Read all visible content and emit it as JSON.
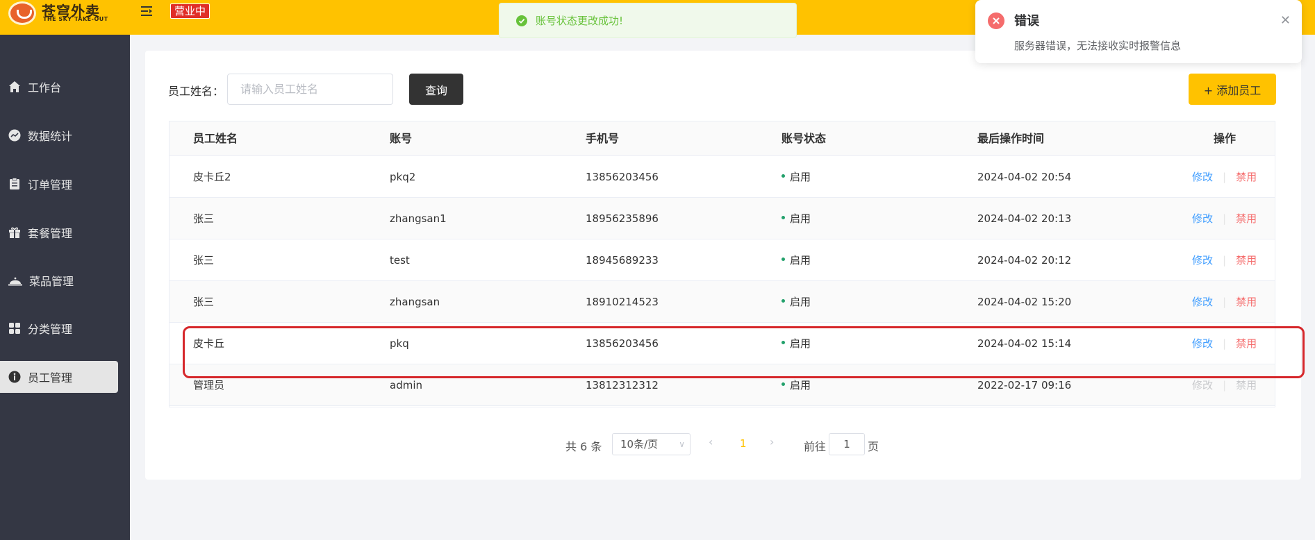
{
  "app": {
    "logo_title": "苍穹外卖",
    "logo_subtitle": "THE SKY TAKE-OUT",
    "shop_status": "营业中"
  },
  "sidebar": {
    "items": [
      {
        "label": "工作台",
        "icon": "home-icon"
      },
      {
        "label": "数据统计",
        "icon": "chart-icon"
      },
      {
        "label": "订单管理",
        "icon": "clipboard-icon"
      },
      {
        "label": "套餐管理",
        "icon": "gift-icon"
      },
      {
        "label": "菜品管理",
        "icon": "cloche-icon"
      },
      {
        "label": "分类管理",
        "icon": "grid-icon"
      },
      {
        "label": "员工管理",
        "icon": "employee-icon",
        "active": true
      }
    ]
  },
  "toolbar": {
    "name_label": "员工姓名：",
    "name_placeholder": "请输入员工姓名",
    "query_label": "查询",
    "add_label": "+ 添加员工"
  },
  "table": {
    "headers": [
      "员工姓名",
      "账号",
      "手机号",
      "账号状态",
      "最后操作时间",
      "操作"
    ],
    "edit_label": "修改",
    "disable_label": "禁用",
    "rows": [
      {
        "name": "皮卡丘2",
        "account": "pkq2",
        "phone": "13856203456",
        "status": "启用",
        "time": "2024-04-02 20:54"
      },
      {
        "name": "张三",
        "account": "zhangsan1",
        "phone": "18956235896",
        "status": "启用",
        "time": "2024-04-02 20:13"
      },
      {
        "name": "张三",
        "account": "test",
        "phone": "18945689233",
        "status": "启用",
        "time": "2024-04-02 20:12"
      },
      {
        "name": "张三",
        "account": "zhangsan",
        "phone": "18910214523",
        "status": "启用",
        "time": "2024-04-02 15:20"
      },
      {
        "name": "皮卡丘",
        "account": "pkq",
        "phone": "13856203456",
        "status": "启用",
        "time": "2024-04-02 15:14"
      },
      {
        "name": "管理员",
        "account": "admin",
        "phone": "13812312312",
        "status": "启用",
        "time": "2022-02-17 09:16"
      }
    ]
  },
  "pagination": {
    "total_text": "共 6 条",
    "page_size": "10条/页",
    "current_page": "1",
    "goto_label": "前往",
    "goto_value": "1",
    "goto_suffix": "页"
  },
  "toast": {
    "message": "账号状态更改成功!"
  },
  "notification": {
    "title": "错误",
    "message": "服务器错误，无法接收实时报警信息"
  },
  "colors": {
    "brand": "#ffc200",
    "sidebar": "#343744",
    "success": "#67c23a",
    "danger": "#f56c6c",
    "link": "#419eff",
    "highlight": "#d6272b"
  }
}
